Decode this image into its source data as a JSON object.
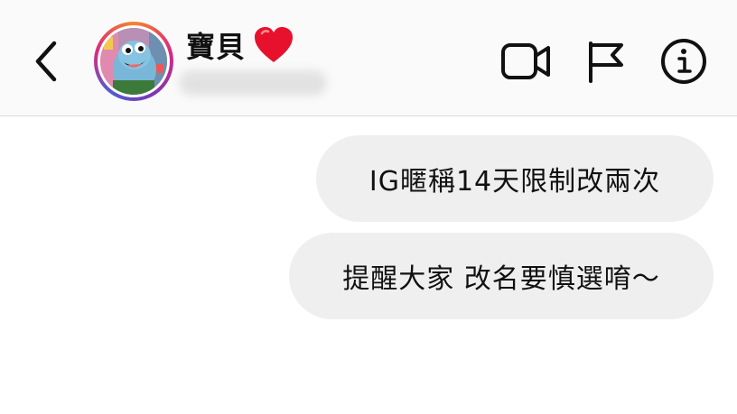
{
  "header": {
    "contact_name": "寶貝",
    "heart_icon": "red-heart-emoji",
    "username_blurred": true,
    "icons": {
      "back": "chevron-left-icon",
      "video": "video-camera-icon",
      "flag": "flag-icon",
      "info": "info-icon"
    }
  },
  "messages": [
    {
      "text": "IG暱稱14天限制改兩次",
      "direction": "outgoing"
    },
    {
      "text": "提醒大家 改名要慎選唷～",
      "direction": "outgoing"
    }
  ],
  "colors": {
    "header_bg": "#fafafa",
    "bubble_bg": "#efefef",
    "text": "#111111",
    "heart": "#e8112d",
    "avatar_ring": "#dd2a7b"
  }
}
